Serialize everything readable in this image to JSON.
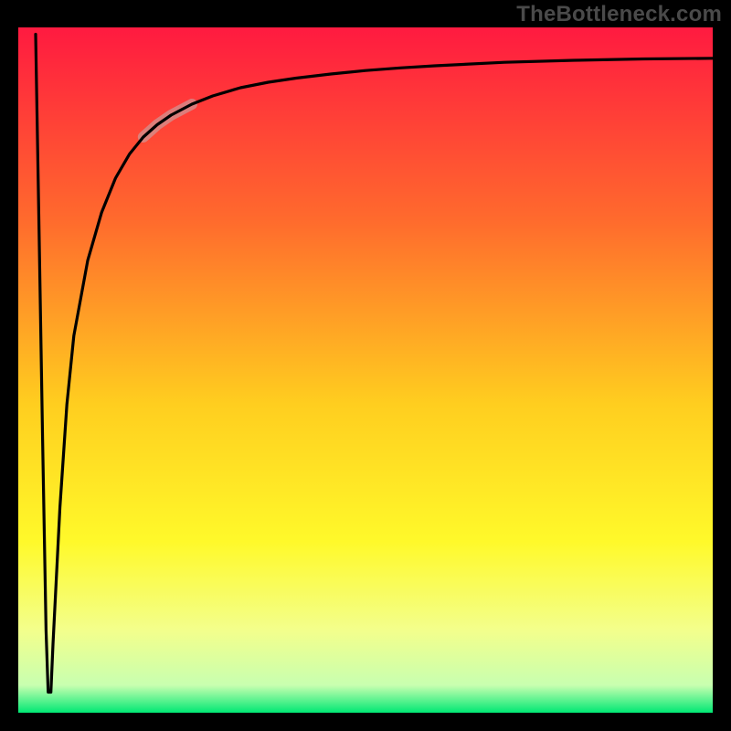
{
  "watermark": "TheBottleneck.com",
  "chart_data": {
    "type": "line",
    "title": "",
    "xlabel": "",
    "ylabel": "",
    "xlim": [
      0,
      100
    ],
    "ylim": [
      0,
      100
    ],
    "grid": false,
    "legend": false,
    "background_gradient": {
      "stops": [
        {
          "offset": 0.0,
          "color": "#ff1a40"
        },
        {
          "offset": 0.28,
          "color": "#ff6a2d"
        },
        {
          "offset": 0.55,
          "color": "#ffce1f"
        },
        {
          "offset": 0.75,
          "color": "#fff92a"
        },
        {
          "offset": 0.88,
          "color": "#f3ff8c"
        },
        {
          "offset": 0.96,
          "color": "#c8ffb0"
        },
        {
          "offset": 1.0,
          "color": "#00e874"
        }
      ]
    },
    "series": [
      {
        "name": "bottleneck-curve",
        "x": [
          2.5,
          3.0,
          3.5,
          4.0,
          4.3,
          4.7,
          5.0,
          6.0,
          7.0,
          8.0,
          10.0,
          12.0,
          14.0,
          16.0,
          18.0,
          20.0,
          22.0,
          25.0,
          28.0,
          32.0,
          36.0,
          40.0,
          45.0,
          50.0,
          55.0,
          60.0,
          70.0,
          80.0,
          90.0,
          100.0
        ],
        "y": [
          99.0,
          70.0,
          40.0,
          12.0,
          3.0,
          3.0,
          10.0,
          30.0,
          45.0,
          55.0,
          66.0,
          73.0,
          78.0,
          81.5,
          84.0,
          85.8,
          87.2,
          88.8,
          90.0,
          91.2,
          92.0,
          92.6,
          93.2,
          93.7,
          94.1,
          94.4,
          94.9,
          95.2,
          95.4,
          95.5
        ]
      }
    ],
    "highlight_segment": {
      "series": "bottleneck-curve",
      "x_range": [
        18.0,
        25.0
      ],
      "stroke": "#caa0a0",
      "stroke_width": 12,
      "opacity": 0.65
    },
    "plot_border": "#000000"
  }
}
